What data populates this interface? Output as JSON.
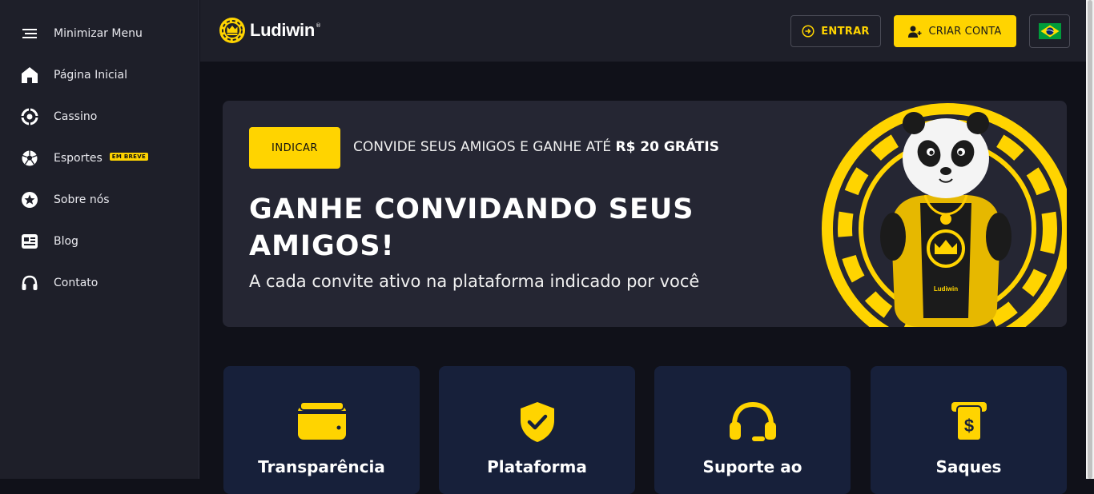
{
  "colors": {
    "accent": "#ffd400",
    "sidebar_bg": "#1e1f29",
    "page_bg": "#101119",
    "banner_bg": "#252633",
    "card_bg": "#17203a"
  },
  "sidebar": {
    "items": [
      {
        "label": "Minimizar Menu",
        "icon": "hamburger-icon"
      },
      {
        "label": "Página Inicial",
        "icon": "home-icon"
      },
      {
        "label": "Cassino",
        "icon": "casino-chip-icon"
      },
      {
        "label": "Esportes",
        "icon": "soccer-ball-icon",
        "badge": "EM BREVE"
      },
      {
        "label": "Sobre nós",
        "icon": "star-icon"
      },
      {
        "label": "Blog",
        "icon": "newspaper-icon"
      },
      {
        "label": "Contato",
        "icon": "headset-icon"
      }
    ]
  },
  "header": {
    "logo": "Ludiwin",
    "logo_reg": "®",
    "login_label": "ENTRAR",
    "signup_label": "CRIAR CONTA",
    "language_icon": "brazil-flag-icon"
  },
  "banner": {
    "button_label": "INDICAR",
    "promo_prefix": "CONVIDE SEUS AMIGOS E GANHE ATÉ ",
    "promo_bold": "R$ 20 GRÁTIS",
    "headline": "GANHE CONVIDANDO SEUS AMIGOS!",
    "subline": "A cada convite ativo na plataforma indicado por você",
    "mascot_label": "Ludiwin"
  },
  "features": [
    {
      "title": "Transparência",
      "icon": "wallet-icon"
    },
    {
      "title": "Plataforma",
      "icon": "shield-check-icon"
    },
    {
      "title": "Suporte ao",
      "icon": "headset-icon"
    },
    {
      "title": "Saques",
      "icon": "money-withdraw-icon"
    }
  ]
}
